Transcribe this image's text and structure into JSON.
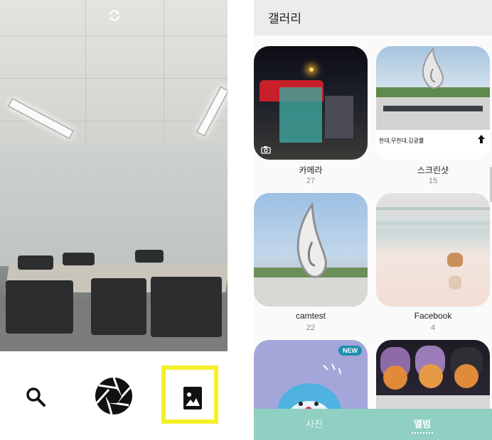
{
  "camera": {
    "rotate_icon": "camera-switch-icon",
    "search_icon": "search-icon",
    "shutter_icon": "shutter-aperture-icon",
    "gallery_icon": "gallery-image-icon",
    "highlight_color": "#f5f02a"
  },
  "gallery": {
    "title": "갤러리",
    "albums": [
      {
        "name": "카메라",
        "count": "27",
        "badge": ""
      },
      {
        "name": "스크린샷",
        "count": "15",
        "badge": ""
      },
      {
        "name": "camtest",
        "count": "22",
        "badge": ""
      },
      {
        "name": "Facebook",
        "count": "4",
        "badge": ""
      },
      {
        "name": "",
        "count": "",
        "badge": "NEW"
      },
      {
        "name": "",
        "count": "",
        "badge": ""
      }
    ],
    "screenshot_caption": "한대,무한대,김광률",
    "tabs": {
      "photos": "사진",
      "albums": "앨범"
    },
    "accent_color": "#8fd0c3"
  }
}
